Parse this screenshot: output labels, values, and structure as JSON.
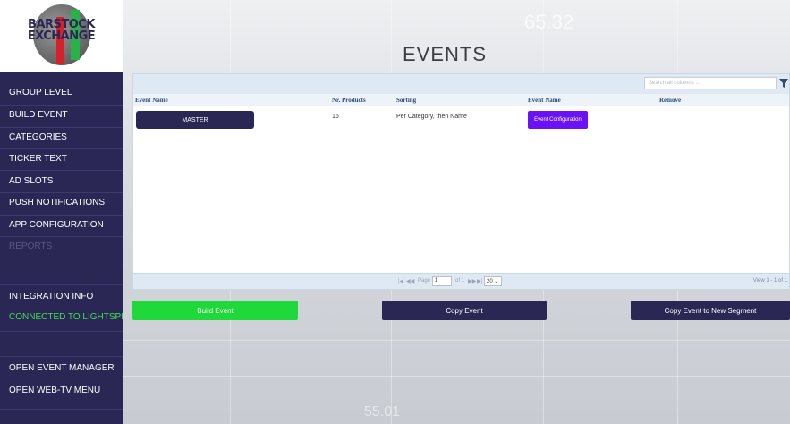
{
  "logo": {
    "text_line1": "BARSTOCK",
    "text_line2": "EXCHANGE"
  },
  "sidebar": {
    "items": [
      {
        "label": "GROUP LEVEL"
      },
      {
        "label": "BUILD EVENT"
      },
      {
        "label": "CATEGORIES"
      },
      {
        "label": "TICKER TEXT"
      },
      {
        "label": "AD SLOTS"
      },
      {
        "label": "PUSH NOTIFICATIONS"
      },
      {
        "label": "APP CONFIGURATION"
      },
      {
        "label": "REPORTS"
      }
    ],
    "integration_info": "INTEGRATION INFO",
    "connected": "CONNECTED TO LIGHTSPEED",
    "open_event_manager": "OPEN EVENT MANAGER",
    "open_webtv_menu": "OPEN WEB-TV MENU"
  },
  "background": {
    "number_top": "65.32",
    "number_bottom": "55.01"
  },
  "page": {
    "title": "EVENTS"
  },
  "grid": {
    "search_placeholder": "Search all columns ...",
    "columns": [
      "Event Name",
      "Nr. Products",
      "Sorting",
      "Event Name",
      "Remove"
    ],
    "rows": [
      {
        "event_name": "MASTER",
        "nr_products": "16",
        "sorting": "Per Category, then Name",
        "config_label": "Event Configuration"
      }
    ],
    "pager": {
      "page_label": "Page",
      "page_value": "1",
      "of_label": "of 1",
      "page_size": "20",
      "view_text": "View 1 - 1 of 1"
    }
  },
  "actions": {
    "build_event": "Build Event",
    "copy_event": "Copy Event",
    "copy_event_new_segment": "Copy Event to New Segment"
  },
  "colors": {
    "sidebar_bg": "#2b2755",
    "build_green": "#1fd93a",
    "config_purple": "#6a12f5",
    "connected_green": "#3ee04e"
  }
}
